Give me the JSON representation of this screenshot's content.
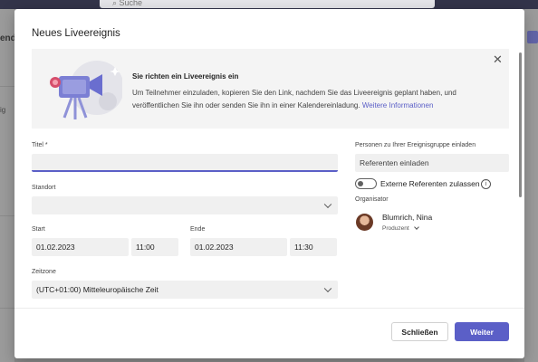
{
  "background": {
    "search_label": "Suche",
    "left_heading_fragment": "end",
    "left_text_fragment": "ig"
  },
  "dialog": {
    "title": "Neues Liveereignis",
    "banner": {
      "title": "Sie richten ein Liveereignis ein",
      "text": "Um Teilnehmer einzuladen, kopieren Sie den Link, nachdem Sie das Liveereignis geplant haben, und veröffentlichen Sie ihn oder senden Sie ihn in einer Kalendereinladung.",
      "link": "Weitere Informationen",
      "close_icon": "close-icon",
      "illustration_icon": "video-camera-illustration"
    },
    "form": {
      "title_label": "Titel *",
      "title_value": "",
      "location_label": "Standort",
      "location_value": "",
      "start_label": "Start",
      "start_date": "01.02.2023",
      "start_time": "11:00",
      "end_label": "Ende",
      "end_date": "01.02.2023",
      "end_time": "11:30",
      "timezone_label": "Zeitzone",
      "timezone_value": "(UTC+01:00) Mitteleuropäische Zeit"
    },
    "side": {
      "invite_label": "Personen zu Ihrer Ereignisgruppe einladen",
      "invite_placeholder": "Referenten einladen",
      "external_toggle_label": "Externe Referenten zulassen",
      "external_toggle_on": false,
      "organizer_label": "Organisator",
      "organizer_name": "Blumrich, Nina",
      "organizer_role": "Produzent"
    },
    "buttons": {
      "close": "Schließen",
      "next": "Weiter"
    }
  },
  "colors": {
    "accent": "#5b5fc7",
    "app_bar": "#33344a"
  }
}
